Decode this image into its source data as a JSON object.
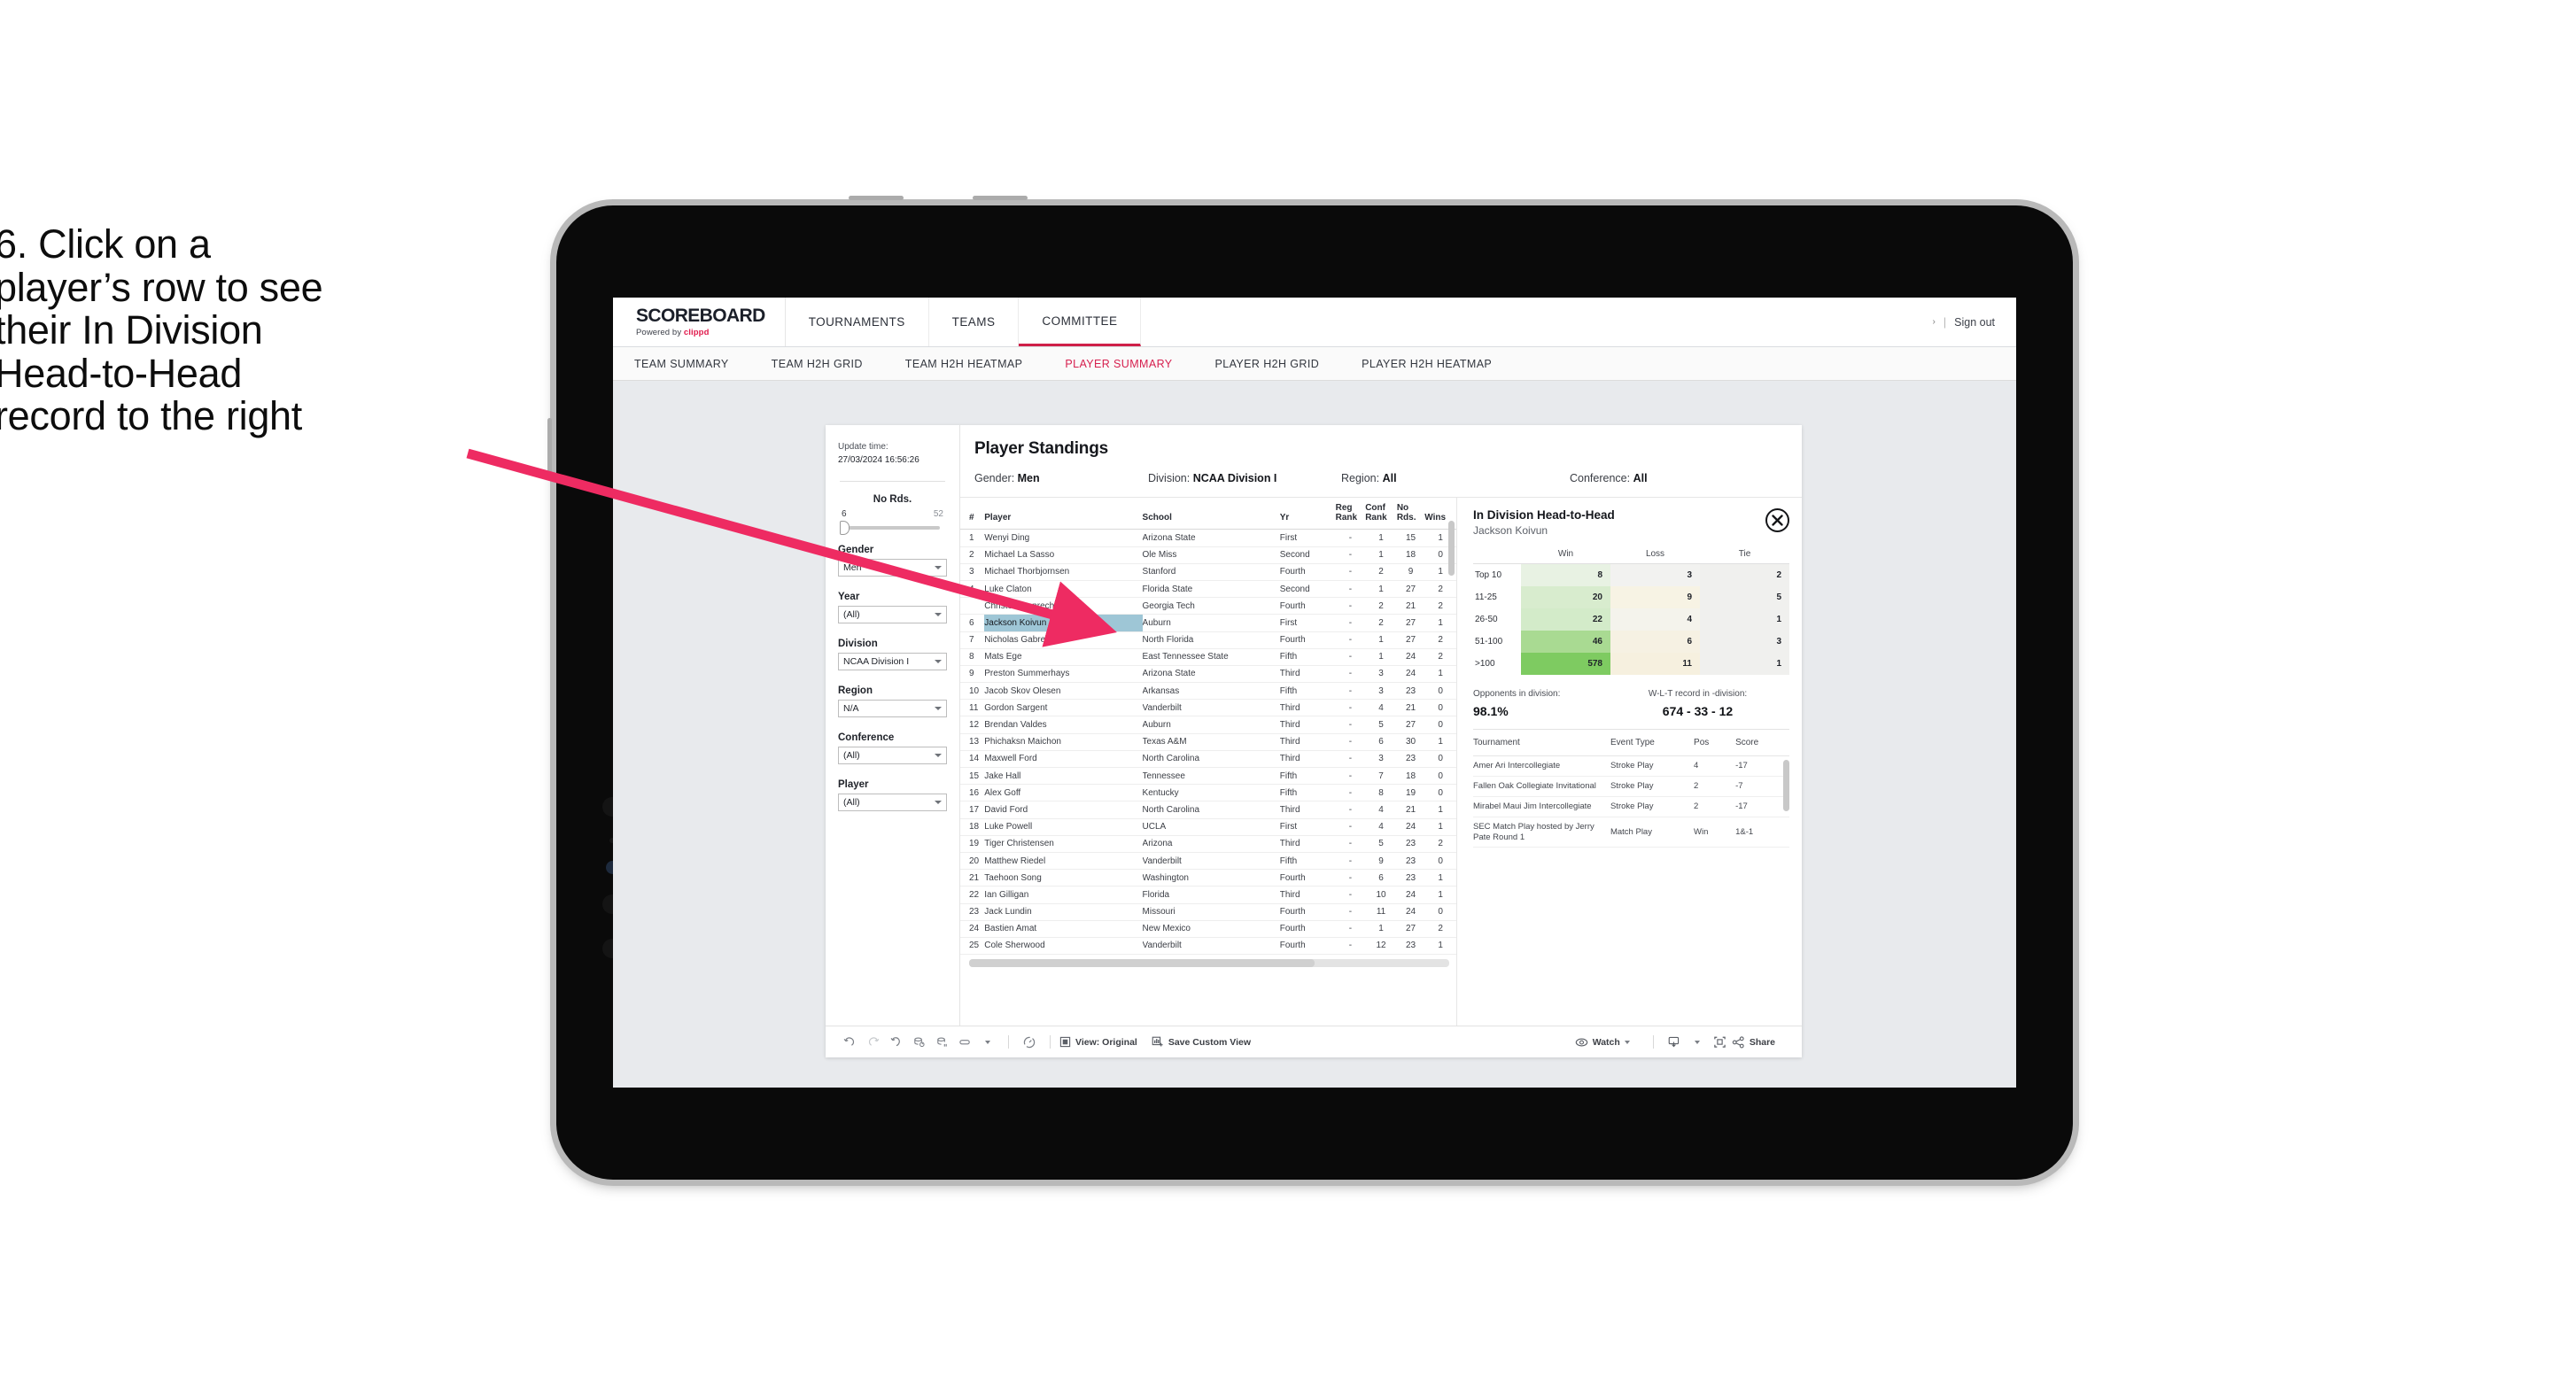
{
  "caption": {
    "lines": [
      "6. Click on a",
      "player’s row to see",
      "their In Division",
      "Head-to-Head",
      "record to the right"
    ],
    "arrow_color": "#ee2b62"
  },
  "app": {
    "brand": {
      "title": "SCOREBOARD",
      "powered_prefix": "Powered by ",
      "powered_brand": "clippd"
    },
    "top_nav": [
      {
        "label": "TOURNAMENTS",
        "active": false
      },
      {
        "label": "TEAMS",
        "active": false
      },
      {
        "label": "COMMITTEE",
        "active": true
      }
    ],
    "top_right": {
      "chevron": "›",
      "separator": "|",
      "sign_out": "Sign out"
    },
    "sub_nav": [
      {
        "label": "TEAM SUMMARY",
        "active": false
      },
      {
        "label": "TEAM H2H GRID",
        "active": false
      },
      {
        "label": "TEAM H2H HEATMAP",
        "active": false
      },
      {
        "label": "PLAYER SUMMARY",
        "active": true
      },
      {
        "label": "PLAYER H2H GRID",
        "active": false
      },
      {
        "label": "PLAYER H2H HEATMAP",
        "active": false
      }
    ],
    "accent_color": "#d61f4e"
  },
  "filters": {
    "update_label": "Update time:",
    "update_value": "27/03/2024 16:56:26",
    "slider": {
      "title": "No Rds.",
      "min": "6",
      "max": "52"
    },
    "groups": [
      {
        "label": "Gender",
        "value": "Men"
      },
      {
        "label": "Year",
        "value": "(All)"
      },
      {
        "label": "Division",
        "value": "NCAA Division I"
      },
      {
        "label": "Region",
        "value": "N/A"
      },
      {
        "label": "Conference",
        "value": "(All)"
      },
      {
        "label": "Player",
        "value": "(All)"
      }
    ]
  },
  "standings": {
    "title": "Player Standings",
    "meta": [
      {
        "label": "Gender: ",
        "value": "Men"
      },
      {
        "label": "Division: ",
        "value": "NCAA Division I"
      },
      {
        "label": "Region: ",
        "value": "All"
      },
      {
        "label": "Conference: ",
        "value": "All"
      }
    ],
    "columns": [
      "#",
      "Player",
      "School",
      "Yr",
      "Reg Rank",
      "Conf Rank",
      "No Rds.",
      "Wins"
    ],
    "columns_wrapped": [
      {
        "l1": "#",
        "l2": ""
      },
      {
        "l1": "",
        "l2": "Player"
      },
      {
        "l1": "",
        "l2": "School"
      },
      {
        "l1": "",
        "l2": "Yr"
      },
      {
        "l1": "Reg",
        "l2": "Rank"
      },
      {
        "l1": "Conf",
        "l2": "Rank"
      },
      {
        "l1": "No",
        "l2": "Rds."
      },
      {
        "l1": "",
        "l2": "Wins"
      }
    ],
    "selected_row_index": 5,
    "rows": [
      {
        "num": "1",
        "player": "Wenyi Ding",
        "school": "Arizona State",
        "yr": "First",
        "reg": "-",
        "conf": "1",
        "rds": "15",
        "wins": "1"
      },
      {
        "num": "2",
        "player": "Michael La Sasso",
        "school": "Ole Miss",
        "yr": "Second",
        "reg": "-",
        "conf": "1",
        "rds": "18",
        "wins": "0"
      },
      {
        "num": "3",
        "player": "Michael Thorbjornsen",
        "school": "Stanford",
        "yr": "Fourth",
        "reg": "-",
        "conf": "2",
        "rds": "9",
        "wins": "1"
      },
      {
        "num": "4",
        "player": "Luke Claton",
        "school": "Florida State",
        "yr": "Second",
        "reg": "-",
        "conf": "1",
        "rds": "27",
        "wins": "2"
      },
      {
        "num": "",
        "player": "Christo Lamprecht",
        "school": "Georgia Tech",
        "yr": "Fourth",
        "reg": "-",
        "conf": "2",
        "rds": "21",
        "wins": "2"
      },
      {
        "num": "6",
        "player": "Jackson Koivun",
        "school": "Auburn",
        "yr": "First",
        "reg": "-",
        "conf": "2",
        "rds": "27",
        "wins": "1"
      },
      {
        "num": "7",
        "player": "Nicholas Gabrelcik",
        "school": "North Florida",
        "yr": "Fourth",
        "reg": "-",
        "conf": "1",
        "rds": "27",
        "wins": "2"
      },
      {
        "num": "8",
        "player": "Mats Ege",
        "school": "East Tennessee State",
        "yr": "Fifth",
        "reg": "-",
        "conf": "1",
        "rds": "24",
        "wins": "2"
      },
      {
        "num": "9",
        "player": "Preston Summerhays",
        "school": "Arizona State",
        "yr": "Third",
        "reg": "-",
        "conf": "3",
        "rds": "24",
        "wins": "1"
      },
      {
        "num": "10",
        "player": "Jacob Skov Olesen",
        "school": "Arkansas",
        "yr": "Fifth",
        "reg": "-",
        "conf": "3",
        "rds": "23",
        "wins": "0"
      },
      {
        "num": "11",
        "player": "Gordon Sargent",
        "school": "Vanderbilt",
        "yr": "Third",
        "reg": "-",
        "conf": "4",
        "rds": "21",
        "wins": "0"
      },
      {
        "num": "12",
        "player": "Brendan Valdes",
        "school": "Auburn",
        "yr": "Third",
        "reg": "-",
        "conf": "5",
        "rds": "27",
        "wins": "0"
      },
      {
        "num": "13",
        "player": "Phichaksn Maichon",
        "school": "Texas A&M",
        "yr": "Third",
        "reg": "-",
        "conf": "6",
        "rds": "30",
        "wins": "1"
      },
      {
        "num": "14",
        "player": "Maxwell Ford",
        "school": "North Carolina",
        "yr": "Third",
        "reg": "-",
        "conf": "3",
        "rds": "23",
        "wins": "0"
      },
      {
        "num": "15",
        "player": "Jake Hall",
        "school": "Tennessee",
        "yr": "Fifth",
        "reg": "-",
        "conf": "7",
        "rds": "18",
        "wins": "0"
      },
      {
        "num": "16",
        "player": "Alex Goff",
        "school": "Kentucky",
        "yr": "Fifth",
        "reg": "-",
        "conf": "8",
        "rds": "19",
        "wins": "0"
      },
      {
        "num": "17",
        "player": "David Ford",
        "school": "North Carolina",
        "yr": "Third",
        "reg": "-",
        "conf": "4",
        "rds": "21",
        "wins": "1"
      },
      {
        "num": "18",
        "player": "Luke Powell",
        "school": "UCLA",
        "yr": "First",
        "reg": "-",
        "conf": "4",
        "rds": "24",
        "wins": "1"
      },
      {
        "num": "19",
        "player": "Tiger Christensen",
        "school": "Arizona",
        "yr": "Third",
        "reg": "-",
        "conf": "5",
        "rds": "23",
        "wins": "2"
      },
      {
        "num": "20",
        "player": "Matthew Riedel",
        "school": "Vanderbilt",
        "yr": "Fifth",
        "reg": "-",
        "conf": "9",
        "rds": "23",
        "wins": "0"
      },
      {
        "num": "21",
        "player": "Taehoon Song",
        "school": "Washington",
        "yr": "Fourth",
        "reg": "-",
        "conf": "6",
        "rds": "23",
        "wins": "1"
      },
      {
        "num": "22",
        "player": "Ian Gilligan",
        "school": "Florida",
        "yr": "Third",
        "reg": "-",
        "conf": "10",
        "rds": "24",
        "wins": "1"
      },
      {
        "num": "23",
        "player": "Jack Lundin",
        "school": "Missouri",
        "yr": "Fourth",
        "reg": "-",
        "conf": "11",
        "rds": "24",
        "wins": "0"
      },
      {
        "num": "24",
        "player": "Bastien Amat",
        "school": "New Mexico",
        "yr": "Fourth",
        "reg": "-",
        "conf": "1",
        "rds": "27",
        "wins": "2"
      },
      {
        "num": "25",
        "player": "Cole Sherwood",
        "school": "Vanderbilt",
        "yr": "Fourth",
        "reg": "-",
        "conf": "12",
        "rds": "23",
        "wins": "1"
      }
    ]
  },
  "h2h": {
    "title": "In Division Head-to-Head",
    "player": "Jackson Koivun",
    "close_icon": "close-circle-icon",
    "matrix": {
      "columns": [
        "Win",
        "Loss",
        "Tie"
      ],
      "rows": [
        {
          "label": "Top 10",
          "win": "8",
          "loss": "3",
          "tie": "2",
          "win_color": "#e8f2e3",
          "loss_color": "#f2f2f0"
        },
        {
          "label": "11-25",
          "win": "20",
          "loss": "9",
          "tie": "5",
          "win_color": "#d8ecce",
          "loss_color": "#f7f3e4"
        },
        {
          "label": "26-50",
          "win": "22",
          "loss": "4",
          "tie": "1",
          "win_color": "#d3ebc9",
          "loss_color": "#f4f3ec"
        },
        {
          "label": "51-100",
          "win": "46",
          "loss": "6",
          "tie": "3",
          "win_color": "#a9da92",
          "loss_color": "#f6f1e3"
        },
        {
          "label": ">100",
          "win": "578",
          "loss": "11",
          "tie": "1",
          "win_color": "#7ecb61",
          "loss_color": "#f6f0df"
        }
      ],
      "tie_color": "#f0f0ee"
    },
    "kpis": [
      {
        "label": "Opponents in division:",
        "value": "98.1%"
      },
      {
        "label": "W-L-T record in -division:",
        "value": "674 - 33 - 12"
      }
    ],
    "tournaments": {
      "columns": [
        "Tournament",
        "Event Type",
        "Pos",
        "Score"
      ],
      "rows": [
        {
          "name": "Amer Ari Intercollegiate",
          "type": "Stroke Play",
          "pos": "4",
          "score": "-17"
        },
        {
          "name": "Fallen Oak Collegiate Invitational",
          "type": "Stroke Play",
          "pos": "2",
          "score": "-7"
        },
        {
          "name": "Mirabel Maui Jim Intercollegiate",
          "type": "Stroke Play",
          "pos": "2",
          "score": "-17"
        },
        {
          "name": "SEC Match Play hosted by Jerry Pate Round 1",
          "type": "Match Play",
          "pos": "Win",
          "score": "1&-1"
        }
      ]
    }
  },
  "toolbar": {
    "view_label": "View: Original",
    "save_label": "Save Custom View",
    "watch_label": "Watch",
    "share_label": "Share"
  }
}
